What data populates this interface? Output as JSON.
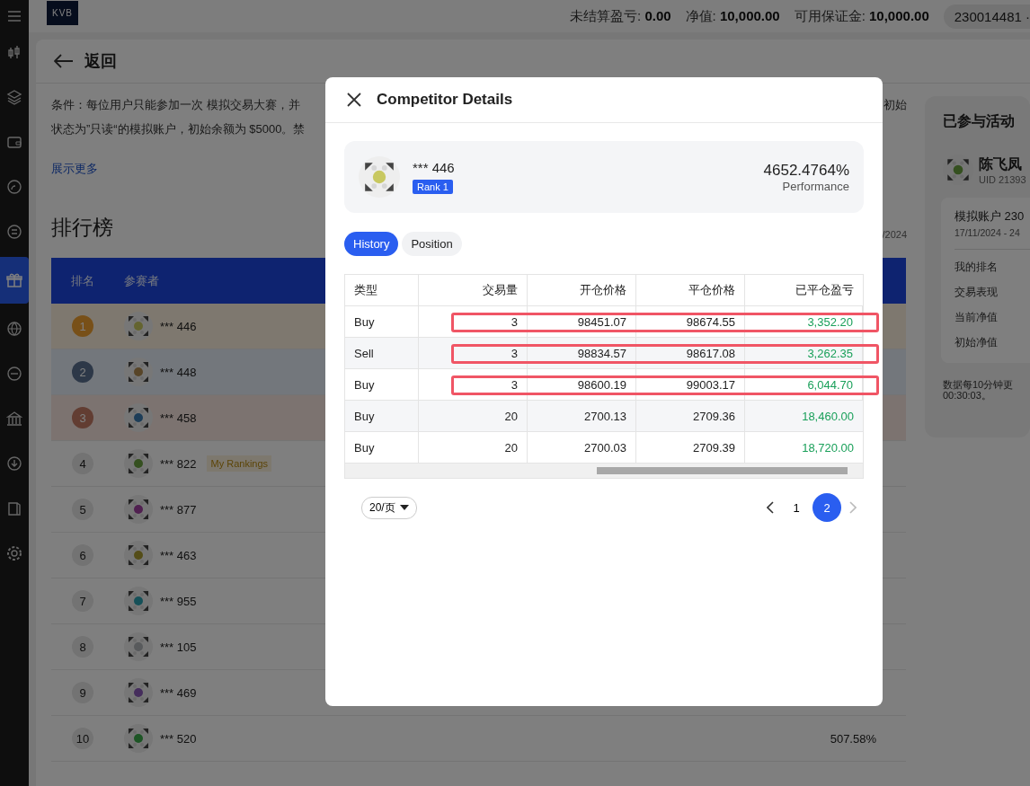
{
  "topbar": {
    "logo": "KVB",
    "stats": [
      {
        "label": "未结算盈亏:",
        "value": "0.00"
      },
      {
        "label": "净值:",
        "value": "10,000.00"
      },
      {
        "label": "可用保证金:",
        "value": "10,000.00"
      }
    ],
    "account": "230014481 ·"
  },
  "sidebar": {
    "items": [
      {
        "selected": false
      },
      {
        "selected": false
      },
      {
        "selected": false
      },
      {
        "selected": false
      },
      {
        "selected": false
      },
      {
        "selected": true
      },
      {
        "selected": false
      },
      {
        "selected": false
      },
      {
        "selected": false
      },
      {
        "selected": false
      },
      {
        "selected": false
      },
      {
        "selected": false
      }
    ]
  },
  "page": {
    "back": "返回",
    "conditions": [
      "条件：每位用户只能参加一次 模拟交易大赛，并",
      "状态为”只读“的模拟账户，初始余额为 $5000。禁"
    ],
    "conditions_right": "初始",
    "show_more": "展示更多"
  },
  "leaderboard": {
    "title": "排行榜",
    "date": "/2024",
    "columns": [
      "排名",
      "参赛者"
    ],
    "rows": [
      {
        "rank": "1",
        "name": "*** 446",
        "podium": true
      },
      {
        "rank": "2",
        "name": "*** 448",
        "podium": true
      },
      {
        "rank": "3",
        "name": "*** 458",
        "podium": true
      },
      {
        "rank": "4",
        "name": "*** 822",
        "podium": false,
        "tag": "My Rankings"
      },
      {
        "rank": "5",
        "name": "*** 877",
        "podium": false
      },
      {
        "rank": "6",
        "name": "*** 463",
        "podium": false
      },
      {
        "rank": "7",
        "name": "*** 955",
        "podium": false
      },
      {
        "rank": "8",
        "name": "*** 105",
        "podium": false
      },
      {
        "rank": "9",
        "name": "*** 469",
        "podium": false
      },
      {
        "rank": "10",
        "name": "*** 520",
        "podium": false,
        "performance": "507.58%"
      }
    ]
  },
  "activity": {
    "title": "已参与活动",
    "user": {
      "name": "陈飞凤",
      "uid": "UID 21393"
    },
    "account": "模拟账户 230",
    "period": "17/11/2024 - 24",
    "labels": [
      "我的排名",
      "交易表现",
      "当前净值",
      "初始净值"
    ],
    "note": [
      "数据每10分钟更",
      "00:30:03。"
    ]
  },
  "modal": {
    "title": "Competitor Details",
    "competitor": {
      "name": "*** 446",
      "rank": "Rank 1",
      "performance": "4652.4764%",
      "performance_label": "Performance"
    },
    "tabs": [
      {
        "label": "History",
        "selected": true
      },
      {
        "label": "Position",
        "selected": false
      }
    ],
    "table": {
      "columns": [
        "类型",
        "交易量",
        "开仓价格",
        "平仓价格",
        "已平仓盈亏"
      ],
      "rows": [
        {
          "cells": [
            "Buy",
            "3",
            "98451.07",
            "98674.55",
            "3,352.20"
          ],
          "highlighted": true
        },
        {
          "cells": [
            "Sell",
            "3",
            "98834.57",
            "98617.08",
            "3,262.35"
          ],
          "highlighted": true
        },
        {
          "cells": [
            "Buy",
            "3",
            "98600.19",
            "99003.17",
            "6,044.70"
          ],
          "highlighted": true
        },
        {
          "cells": [
            "Buy",
            "20",
            "2700.13",
            "2709.36",
            "18,460.00"
          ],
          "highlighted": false
        },
        {
          "cells": [
            "Buy",
            "20",
            "2700.03",
            "2709.39",
            "18,720.00"
          ],
          "highlighted": false
        }
      ]
    },
    "page_size": "20/页",
    "pages": [
      {
        "label": "1",
        "selected": false
      },
      {
        "label": "2",
        "selected": true
      }
    ],
    "next_disabled": true
  }
}
